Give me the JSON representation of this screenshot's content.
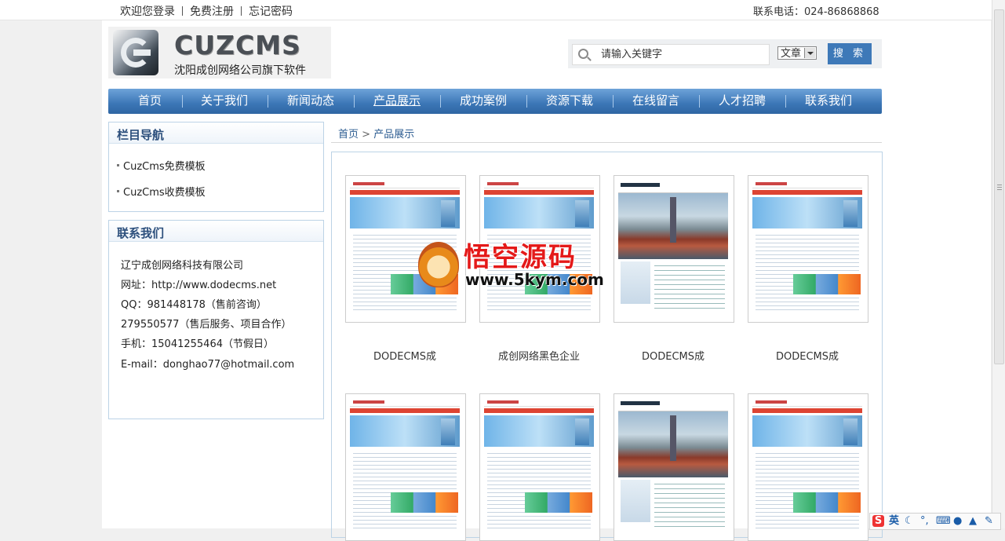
{
  "topbar": {
    "links": [
      "欢迎您登录",
      "免费注册",
      "忘记密码"
    ],
    "phone": "联系电话：024-86868868"
  },
  "logo": {
    "title": "CUZCMS",
    "subtitle": "沈阳成创网络公司旗下软件"
  },
  "search": {
    "placeholder": "请输入关键字",
    "type_selected": "文章",
    "button": "搜 索",
    "icon": "search-icon"
  },
  "nav": [
    "首页",
    "关于我们",
    "新闻动态",
    "产品展示",
    "成功案例",
    "资源下载",
    "在线留言",
    "人才招聘",
    "联系我们"
  ],
  "sidebar": {
    "categories": {
      "title": "栏目导航",
      "items": [
        "CuzCms免费模板",
        "CuzCms收费模板"
      ]
    },
    "contact": {
      "title": "联系我们",
      "lines": [
        "辽宁成创网络科技有限公司",
        "网址：http://www.dodecms.net",
        "QQ：981448178（售前咨询）",
        "279550577（售后服务、项目合作）",
        "手机：15041255464（节假日）",
        "E-mail：donghao77@hotmail.com"
      ]
    }
  },
  "breadcrumb": {
    "home": "首页",
    "separator": ">",
    "current": "产品展示"
  },
  "products": [
    {
      "label": "DODECMS成",
      "style": "blue"
    },
    {
      "label": "成创网络黑色企业",
      "style": "blue"
    },
    {
      "label": "DODECMS成",
      "style": "port"
    },
    {
      "label": "DODECMS成",
      "style": "blue"
    },
    {
      "label": "",
      "style": "blue"
    },
    {
      "label": "",
      "style": "blue"
    },
    {
      "label": "",
      "style": "port"
    },
    {
      "label": "",
      "style": "blue"
    }
  ],
  "watermark": {
    "title": "悟空源码",
    "url": "www.5kym.com"
  },
  "ime": {
    "mode": "英",
    "icons": [
      "sogou-icon",
      "moon-icon",
      "punctuation-icon",
      "keyboard-icon",
      "user-icon",
      "shirt-icon",
      "wrench-icon"
    ]
  }
}
